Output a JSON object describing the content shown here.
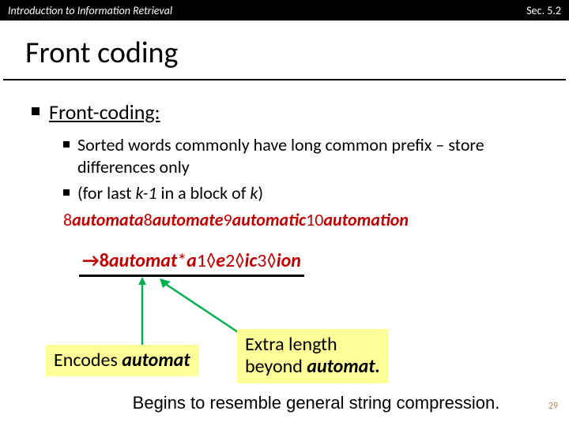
{
  "header": {
    "left": "Introduction to Information Retrieval",
    "right": "Sec. 5.2"
  },
  "title": "Front coding",
  "bullets": {
    "b1": "Front-coding:",
    "b2a": "Sorted words commonly have long common prefix – store differences only",
    "b2b_pre": "(for last ",
    "b2b_k1": "k-1",
    "b2b_mid": " in a block of ",
    "b2b_k": "k",
    "b2b_post": ")"
  },
  "example1": {
    "p1": "8",
    "w1": "automata",
    "p2": "8",
    "w2": "automate",
    "p3": "9",
    "w3": "automatic",
    "p4": "10",
    "w4": "automation"
  },
  "arrowline": {
    "arrow": "→",
    "l1": "8",
    "w1": "automat",
    "star": "*",
    "s1": "a",
    "n1": "1",
    "d": "◊",
    "s2": "e",
    "n2": "2",
    "s3": "ic",
    "n3": "3",
    "s4": "ion"
  },
  "callout1": {
    "pre": "Encodes ",
    "it": "automat"
  },
  "callout2": {
    "line1": "Extra length",
    "line2_pre": "beyond ",
    "line2_it": "automat."
  },
  "footer": "Begins to resemble general string compression.",
  "pagenum": "29"
}
